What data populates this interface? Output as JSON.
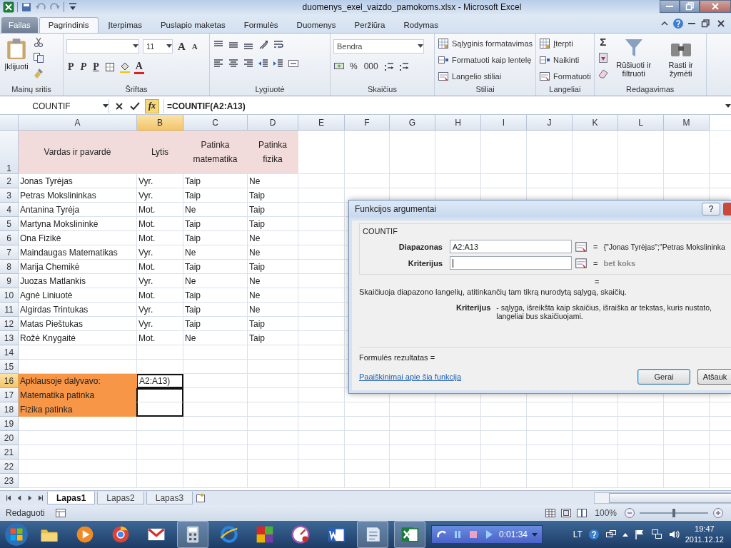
{
  "window": {
    "title": "duomenys_exel_vaizdo_pamokoms.xlsx  -  Microsoft Excel"
  },
  "ribbon_tabs": [
    {
      "label": "Failas",
      "kind": "file",
      "selected": false
    },
    {
      "label": "Pagrindinis",
      "kind": "tab",
      "selected": true
    },
    {
      "label": "Įterpimas",
      "kind": "tab",
      "selected": false
    },
    {
      "label": "Puslapio maketas",
      "kind": "tab",
      "selected": false
    },
    {
      "label": "Formulės",
      "kind": "tab",
      "selected": false
    },
    {
      "label": "Duomenys",
      "kind": "tab",
      "selected": false
    },
    {
      "label": "Peržiūra",
      "kind": "tab",
      "selected": false
    },
    {
      "label": "Rodymas",
      "kind": "tab",
      "selected": false
    }
  ],
  "ribbon_groups": [
    {
      "label": "Mainų sritis",
      "kind": "clipboard",
      "button": "Įklijuoti"
    },
    {
      "label": "Šriftas",
      "kind": "font",
      "size": "11",
      "grow": "A",
      "shrink": "A",
      "bold": "P",
      "italic": "P",
      "underline": "P",
      "color_button": "A"
    },
    {
      "label": "Lygiuotė",
      "kind": "alignment"
    },
    {
      "label": "Skaičius",
      "kind": "number",
      "format": "Bendra",
      "percent": "%",
      "thousands": "000"
    },
    {
      "label": "Stiliai",
      "kind": "list",
      "items": [
        "Sąlyginis formatavimas",
        "Formatuoti kaip lentelę",
        "Langelio stiliai"
      ]
    },
    {
      "label": "Langeliai",
      "kind": "list",
      "items": [
        "Įterpti",
        "Naikinti",
        "Formatuoti"
      ]
    },
    {
      "label": "Redagavimas",
      "kind": "editing",
      "sum": "Σ",
      "buttons": [
        "Rūšiuoti ir filtruoti",
        "Rasti ir žymėti"
      ]
    }
  ],
  "formula_bar": {
    "name_box": "COUNTIF",
    "fx": "fx",
    "formula": "=COUNTIF(A2:A13)"
  },
  "sheet": {
    "columns": [
      {
        "label": "A",
        "selected": false
      },
      {
        "label": "B",
        "selected": true
      },
      {
        "label": "C",
        "selected": false
      },
      {
        "label": "D",
        "selected": false
      },
      {
        "label": "E",
        "selected": false
      },
      {
        "label": "F",
        "selected": false
      },
      {
        "label": "G",
        "selected": false
      },
      {
        "label": "H",
        "selected": false
      },
      {
        "label": "I",
        "selected": false
      },
      {
        "label": "J",
        "selected": false
      },
      {
        "label": "K",
        "selected": false
      },
      {
        "label": "L",
        "selected": false
      },
      {
        "label": "M",
        "selected": false
      }
    ],
    "rows": [
      {
        "number": "1",
        "kind": "header",
        "selected": false,
        "cells": [
          "Vardas ir pavardė",
          "Lytis",
          "Patinka matematika",
          "Patinka fizika"
        ]
      },
      {
        "number": "2",
        "kind": "data",
        "selected": false,
        "cells": [
          "Jonas Tyrėjas",
          "Vyr.",
          "Taip",
          "Ne"
        ]
      },
      {
        "number": "3",
        "kind": "data",
        "selected": false,
        "cells": [
          "Petras Mokslininkas",
          "Vyr.",
          "Taip",
          "Taip"
        ]
      },
      {
        "number": "4",
        "kind": "data",
        "selected": false,
        "cells": [
          "Antanina Tyrėja",
          "Mot.",
          "Ne",
          "Taip"
        ]
      },
      {
        "number": "5",
        "kind": "data",
        "selected": false,
        "cells": [
          "Martyna Mokslininkė",
          "Mot.",
          "Taip",
          "Taip"
        ]
      },
      {
        "number": "6",
        "kind": "data",
        "selected": false,
        "cells": [
          "Ona Fizikė",
          "Mot.",
          "Taip",
          "Ne"
        ]
      },
      {
        "number": "7",
        "kind": "data",
        "selected": false,
        "cells": [
          "Maindaugas Matematikas",
          "Vyr.",
          "Ne",
          "Ne"
        ]
      },
      {
        "number": "8",
        "kind": "data",
        "selected": false,
        "cells": [
          "Marija Chemikė",
          "Mot.",
          "Taip",
          "Taip"
        ]
      },
      {
        "number": "9",
        "kind": "data",
        "selected": false,
        "cells": [
          "Juozas Matlankis",
          "Vyr.",
          "Ne",
          "Ne"
        ]
      },
      {
        "number": "10",
        "kind": "data",
        "selected": false,
        "cells": [
          "Agnė Liniuotė",
          "Mot.",
          "Taip",
          "Ne"
        ]
      },
      {
        "number": "11",
        "kind": "data",
        "selected": false,
        "cells": [
          "Algirdas Trintukas",
          "Vyr.",
          "Taip",
          "Ne"
        ]
      },
      {
        "number": "12",
        "kind": "data",
        "selected": false,
        "cells": [
          "Matas Pieštukas",
          "Vyr.",
          "Taip",
          "Taip"
        ]
      },
      {
        "number": "13",
        "kind": "data",
        "selected": false,
        "cells": [
          "Rožė Knygaitė",
          "Mot.",
          "Ne",
          "Taip"
        ]
      },
      {
        "number": "14",
        "kind": "data",
        "selected": false,
        "cells": []
      },
      {
        "number": "15",
        "kind": "data",
        "selected": false,
        "cells": []
      },
      {
        "number": "16",
        "kind": "summary",
        "selected": true,
        "outlined": false,
        "cells": [
          "Apklausoje dalyvavo:",
          "A2:A13)"
        ]
      },
      {
        "number": "17",
        "kind": "summary",
        "selected": false,
        "outlined": true,
        "cells": [
          "Matematika patinka"
        ]
      },
      {
        "number": "18",
        "kind": "summary",
        "selected": false,
        "outlined": true,
        "cells": [
          "Fizika patinka"
        ]
      },
      {
        "number": "19",
        "kind": "data",
        "selected": false,
        "cells": []
      },
      {
        "number": "20",
        "kind": "data",
        "selected": false,
        "cells": []
      },
      {
        "number": "21",
        "kind": "data",
        "selected": false,
        "cells": []
      },
      {
        "number": "22",
        "kind": "data",
        "selected": false,
        "cells": []
      },
      {
        "number": "23",
        "kind": "data",
        "selected": false,
        "cells": []
      }
    ]
  },
  "sheet_tabs": [
    {
      "label": "Lapas1",
      "selected": true
    },
    {
      "label": "Lapas2",
      "selected": false
    },
    {
      "label": "Lapas3",
      "selected": false
    }
  ],
  "status_bar": {
    "mode": "Redaguoti",
    "zoom": "100%",
    "zoom_slider": {
      "level": 0.5
    }
  },
  "dialog": {
    "title": "Funkcijos argumentai",
    "help": "?",
    "function_name": "COUNTIF",
    "arguments": [
      {
        "label": "Diapazonas",
        "value": "A2:A13",
        "equals": "=",
        "result": "{\"Jonas Tyrėjas\";\"Petras Mokslininka",
        "kind": "value",
        "focused": false
      },
      {
        "label": "Kriterijus",
        "equals": "=",
        "result": "bet koks",
        "kind": "hint",
        "focused": true
      }
    ],
    "total_equals": "=",
    "description": "Skaičiuoja diapazono langelių, atitinkančių tam tikrą nurodytą sąlygą, skaičių.",
    "help_label": "Kriterijus",
    "help_lines": [
      "- sąlyga, išreikšta kaip skaičius, išraiška ar tekstas, kuris nustato,",
      "langeliai bus skaičiuojami."
    ],
    "result_label": "Formulės rezultatas =",
    "link": "Paaiškinimai apie šia funkcija",
    "buttons": [
      "Gerai",
      "Atšauk"
    ]
  },
  "taskbar": {
    "recorder_time": "0:01:34",
    "language": "LT",
    "time": "19:47",
    "date": "2011.12.12"
  }
}
